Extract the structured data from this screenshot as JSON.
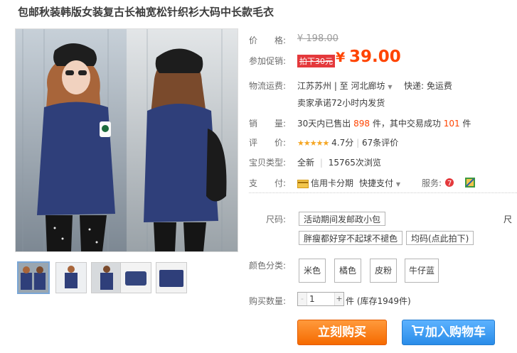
{
  "product": {
    "title": "包邮秋装韩版女装复古长袖宽松针织衫大码中长款毛衣"
  },
  "price": {
    "label": "价　　格:",
    "original": "¥ 198.00"
  },
  "promo": {
    "label": "参加促销:",
    "tag": "拍下30元",
    "currency": "¥",
    "price": "39.00"
  },
  "shipping": {
    "label": "物流运费:",
    "route": "江苏苏州 | 至  河北廊坊",
    "express": "快递: 免运费",
    "note": "卖家承诺72小时内发货"
  },
  "sales": {
    "label": "销　　量:",
    "prefix": "30天内已售出",
    "sold": "898",
    "mid": "件，其中交易成功",
    "success": "101",
    "suffix": "件"
  },
  "rating": {
    "label": "评　　价:",
    "stars": "★★★★★",
    "score": "4.7分",
    "separator": "|",
    "count": "67条评价"
  },
  "item_type": {
    "label": "宝贝类型:",
    "condition": "全新",
    "separator": "|",
    "views": "15765次浏览"
  },
  "payment": {
    "label": "支　　付:",
    "card": "信用卡分期",
    "quick": "快捷支付",
    "service_label": "服务:"
  },
  "size": {
    "label": "尺码:",
    "options": [
      "活动期间发邮政小包",
      "胖瘦都好穿不起球不褪色",
      "均码(点此拍下)"
    ],
    "overflow": "尺"
  },
  "color": {
    "label": "颜色分类:",
    "options": [
      "米色",
      "橘色",
      "皮粉",
      "牛仔蓝"
    ]
  },
  "quantity": {
    "label": "购买数量:",
    "value": "1",
    "minus": "-",
    "plus": "+",
    "stock": "件 (库存1949件)"
  },
  "actions": {
    "buy_now": "立刻购买",
    "add_to_cart": "加入购物车"
  },
  "colors": {
    "accent": "#ff4400",
    "buy_button": "#f56a00",
    "cart_button": "#2a8ce8",
    "promo_tag": "#e4393c"
  },
  "icons": {
    "card": "credit-card-icon",
    "service1": "seven-day-return-icon",
    "service2": "guarantee-icon",
    "cart": "shopping-cart-icon"
  }
}
